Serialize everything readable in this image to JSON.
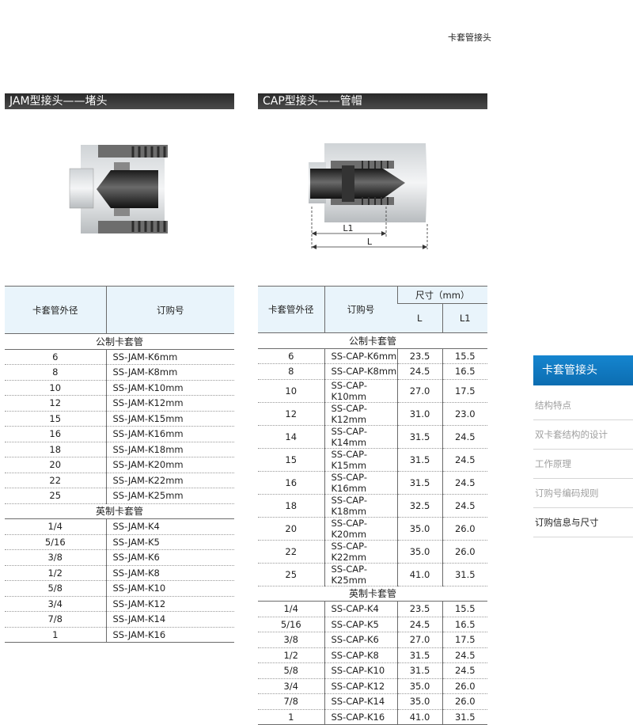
{
  "page_title": "卡套管接头",
  "left": {
    "section_title": "JAM型接头——堵头",
    "headers": {
      "od": "卡套管外径",
      "pn": "订购号"
    },
    "metric_label": "公制卡套管",
    "metric": [
      [
        "6",
        "SS-JAM-K6mm"
      ],
      [
        "8",
        "SS-JAM-K8mm"
      ],
      [
        "10",
        "SS-JAM-K10mm"
      ],
      [
        "12",
        "SS-JAM-K12mm"
      ],
      [
        "15",
        "SS-JAM-K15mm"
      ],
      [
        "16",
        "SS-JAM-K16mm"
      ],
      [
        "18",
        "SS-JAM-K18mm"
      ],
      [
        "20",
        "SS-JAM-K20mm"
      ],
      [
        "22",
        "SS-JAM-K22mm"
      ],
      [
        "25",
        "SS-JAM-K25mm"
      ]
    ],
    "imperial_label": "英制卡套管",
    "imperial": [
      [
        "1/4",
        "SS-JAM-K4"
      ],
      [
        "5/16",
        "SS-JAM-K5"
      ],
      [
        "3/8",
        "SS-JAM-K6"
      ],
      [
        "1/2",
        "SS-JAM-K8"
      ],
      [
        "5/8",
        "SS-JAM-K10"
      ],
      [
        "3/4",
        "SS-JAM-K12"
      ],
      [
        "7/8",
        "SS-JAM-K14"
      ],
      [
        "1",
        "SS-JAM-K16"
      ]
    ]
  },
  "right": {
    "section_title": "CAP型接头——管帽",
    "dim_L1": "L1",
    "dim_L": "L",
    "headers": {
      "od": "卡套管外径",
      "pn": "订购号",
      "size": "尺寸（mm）",
      "L": "L",
      "L1": "L1"
    },
    "metric_label": "公制卡套管",
    "metric": [
      [
        "6",
        "SS-CAP-K6mm",
        "23.5",
        "15.5"
      ],
      [
        "8",
        "SS-CAP-K8mm",
        "24.5",
        "16.5"
      ],
      [
        "10",
        "SS-CAP-K10mm",
        "27.0",
        "17.5"
      ],
      [
        "12",
        "SS-CAP-K12mm",
        "31.0",
        "23.0"
      ],
      [
        "14",
        "SS-CAP-K14mm",
        "31.5",
        "24.5"
      ],
      [
        "15",
        "SS-CAP-K15mm",
        "31.5",
        "24.5"
      ],
      [
        "16",
        "SS-CAP-K16mm",
        "31.5",
        "24.5"
      ],
      [
        "18",
        "SS-CAP-K18mm",
        "32.5",
        "24.5"
      ],
      [
        "20",
        "SS-CAP-K20mm",
        "35.0",
        "26.0"
      ],
      [
        "22",
        "SS-CAP-K22mm",
        "35.0",
        "26.0"
      ],
      [
        "25",
        "SS-CAP-K25mm",
        "41.0",
        "31.5"
      ]
    ],
    "imperial_label": "英制卡套管",
    "imperial": [
      [
        "1/4",
        "SS-CAP-K4",
        "23.5",
        "15.5"
      ],
      [
        "5/16",
        "SS-CAP-K5",
        "24.5",
        "16.5"
      ],
      [
        "3/8",
        "SS-CAP-K6",
        "27.0",
        "17.5"
      ],
      [
        "1/2",
        "SS-CAP-K8",
        "31.5",
        "24.5"
      ],
      [
        "5/8",
        "SS-CAP-K10",
        "31.5",
        "24.5"
      ],
      [
        "3/4",
        "SS-CAP-K12",
        "35.0",
        "26.0"
      ],
      [
        "7/8",
        "SS-CAP-K14",
        "35.0",
        "26.0"
      ],
      [
        "1",
        "SS-CAP-K16",
        "41.0",
        "31.5"
      ]
    ]
  },
  "sidebar": {
    "active": "卡套管接头",
    "items": [
      "结构特点",
      "双卡套结构的设计",
      "工作原理",
      "订购号编码规则",
      "订购信息与尺寸"
    ]
  },
  "colors": {
    "accent": "#1176bf",
    "header_bg": "#e9f4fb",
    "bar": "#333333"
  }
}
